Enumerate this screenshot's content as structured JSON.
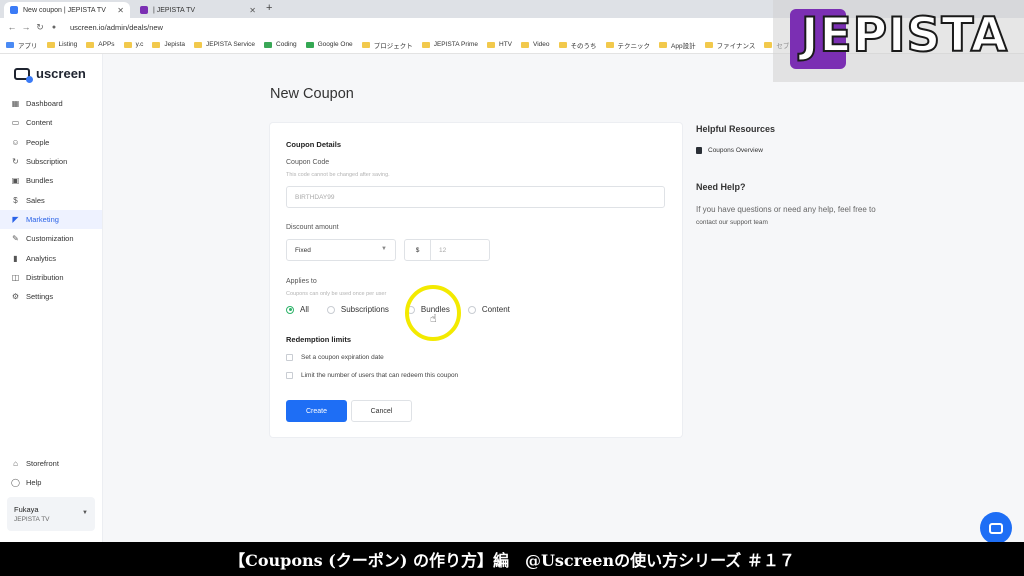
{
  "browser": {
    "tabs": [
      {
        "title": "New coupon | JEPISTA TV",
        "active": true
      },
      {
        "title": "| JEPISTA TV",
        "active": false
      }
    ],
    "new_tab": "+",
    "url": "uscreen.io/admin/deals/new",
    "bookmarks": [
      "アプリ",
      "Listing",
      "APPs",
      "y.c",
      "Jepista",
      "JEPISTA Service",
      "Coding",
      "Google One",
      "プロジェクト",
      "JEPISTA Prime",
      "HTV",
      "Video",
      "そのうち",
      "テクニック",
      "App設計",
      "ファイナンス",
      "セブ"
    ]
  },
  "sidebar": {
    "brand": "uscreen",
    "items": [
      {
        "label": "Dashboard",
        "icon": "grid-icon"
      },
      {
        "label": "Content",
        "icon": "folder-icon"
      },
      {
        "label": "People",
        "icon": "people-icon"
      },
      {
        "label": "Subscription",
        "icon": "refresh-icon"
      },
      {
        "label": "Bundles",
        "icon": "box-icon"
      },
      {
        "label": "Sales",
        "icon": "dollar-icon"
      },
      {
        "label": "Marketing",
        "icon": "megaphone-icon",
        "active": true
      },
      {
        "label": "Customization",
        "icon": "edit-icon"
      },
      {
        "label": "Analytics",
        "icon": "chart-icon"
      },
      {
        "label": "Distribution",
        "icon": "distribution-icon"
      },
      {
        "label": "Settings",
        "icon": "gear-icon"
      }
    ],
    "bottom_items": [
      {
        "label": "Storefront",
        "icon": "store-icon"
      },
      {
        "label": "Help",
        "icon": "help-icon"
      }
    ],
    "account": {
      "name": "Fukaya",
      "org": "JEPISTA TV"
    }
  },
  "main": {
    "title": "New Coupon",
    "form": {
      "section_title": "Coupon Details",
      "code_label": "Coupon Code",
      "code_hint": "This code cannot be changed after saving.",
      "code_placeholder": "BIRTHDAY99",
      "discount_label": "Discount amount",
      "discount_type": "Fixed",
      "currency": "$",
      "amount_placeholder": "12",
      "applies_label": "Applies to",
      "applies_hint": "Coupons can only be used once per user",
      "applies_options": [
        "All",
        "Subscriptions",
        "Bundles",
        "Content"
      ],
      "applies_selected": "All",
      "redemption_title": "Redemption limits",
      "redemption_options": [
        "Set a coupon expiration date",
        "Limit the number of users that can redeem this coupon"
      ],
      "create_label": "Create",
      "cancel_label": "Cancel"
    },
    "resources": {
      "title": "Helpful Resources",
      "link": "Coupons Overview",
      "help_title": "Need Help?",
      "help_text": "If you have questions or need any help, feel free to",
      "help_link": "contact our support team"
    }
  },
  "overlay": {
    "watermark": "JEPISTA",
    "caption": "【Coupons (クーポン) の作り方】編　@Uscreenの使い方シリーズ ＃１７"
  },
  "colors": {
    "primary": "#1e6ef5",
    "radio_selected": "#2fb36a",
    "highlight": "#f3ea00",
    "brand_purple": "#7b2fb3"
  }
}
